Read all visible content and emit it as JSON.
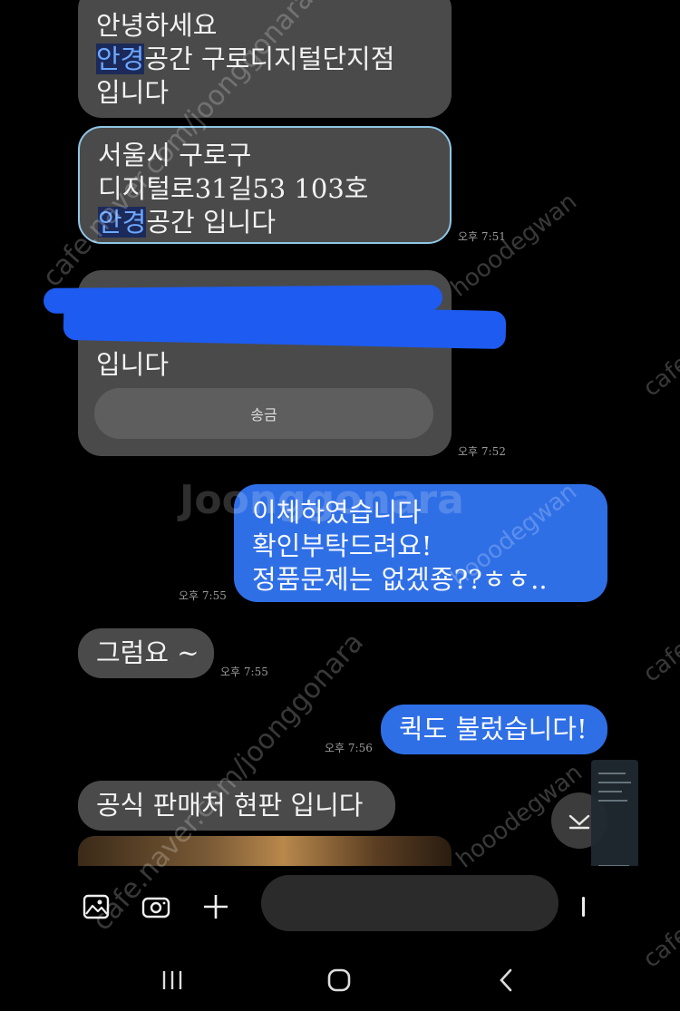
{
  "messages": {
    "m1": {
      "lines": [
        "안녕하세요",
        "공간 구로디지털단지점",
        "입니다"
      ],
      "highlight": "안경"
    },
    "m2": {
      "lines": [
        "서울시 구로구",
        "디지털로31길53 103호",
        "공간 입니다"
      ],
      "highlight": "안경",
      "time": "오후 7:51"
    },
    "m3": {
      "lines": [
        "입니다"
      ],
      "button": "송금",
      "time": "오후 7:52"
    },
    "m4": {
      "lines": [
        "이체하였습니다",
        "확인부탁드려요!",
        "정품문제는 없겠죵??ㅎㅎ.."
      ],
      "time": "오후 7:55"
    },
    "m5": {
      "lines": [
        "그럼요 ~"
      ],
      "time": "오후 7:55"
    },
    "m6": {
      "lines": [
        "퀵도 불렀습니다!"
      ],
      "time": "오후 7:56"
    },
    "m7": {
      "lines": [
        "공식 판매처 현판 입니다"
      ]
    }
  },
  "watermarks": {
    "cafe_url": "cafe.naver.com/joonggonara",
    "brand": "Joonggonara",
    "user": "hooodegwan",
    "cafe": "cafe"
  },
  "colors": {
    "received_bubble": "#4a4a4a",
    "sent_bubble": "#2f6fe6",
    "highlight_text": "#6ea8ff",
    "background": "#000000"
  },
  "icons": {
    "gallery": "gallery-icon",
    "camera": "camera-icon",
    "plus": "plus-icon",
    "emoji": "sticker-icon",
    "scroll_down": "chevron-down-icon",
    "nav_recent": "recent-apps-icon",
    "nav_home": "home-icon",
    "nav_back": "back-icon"
  }
}
